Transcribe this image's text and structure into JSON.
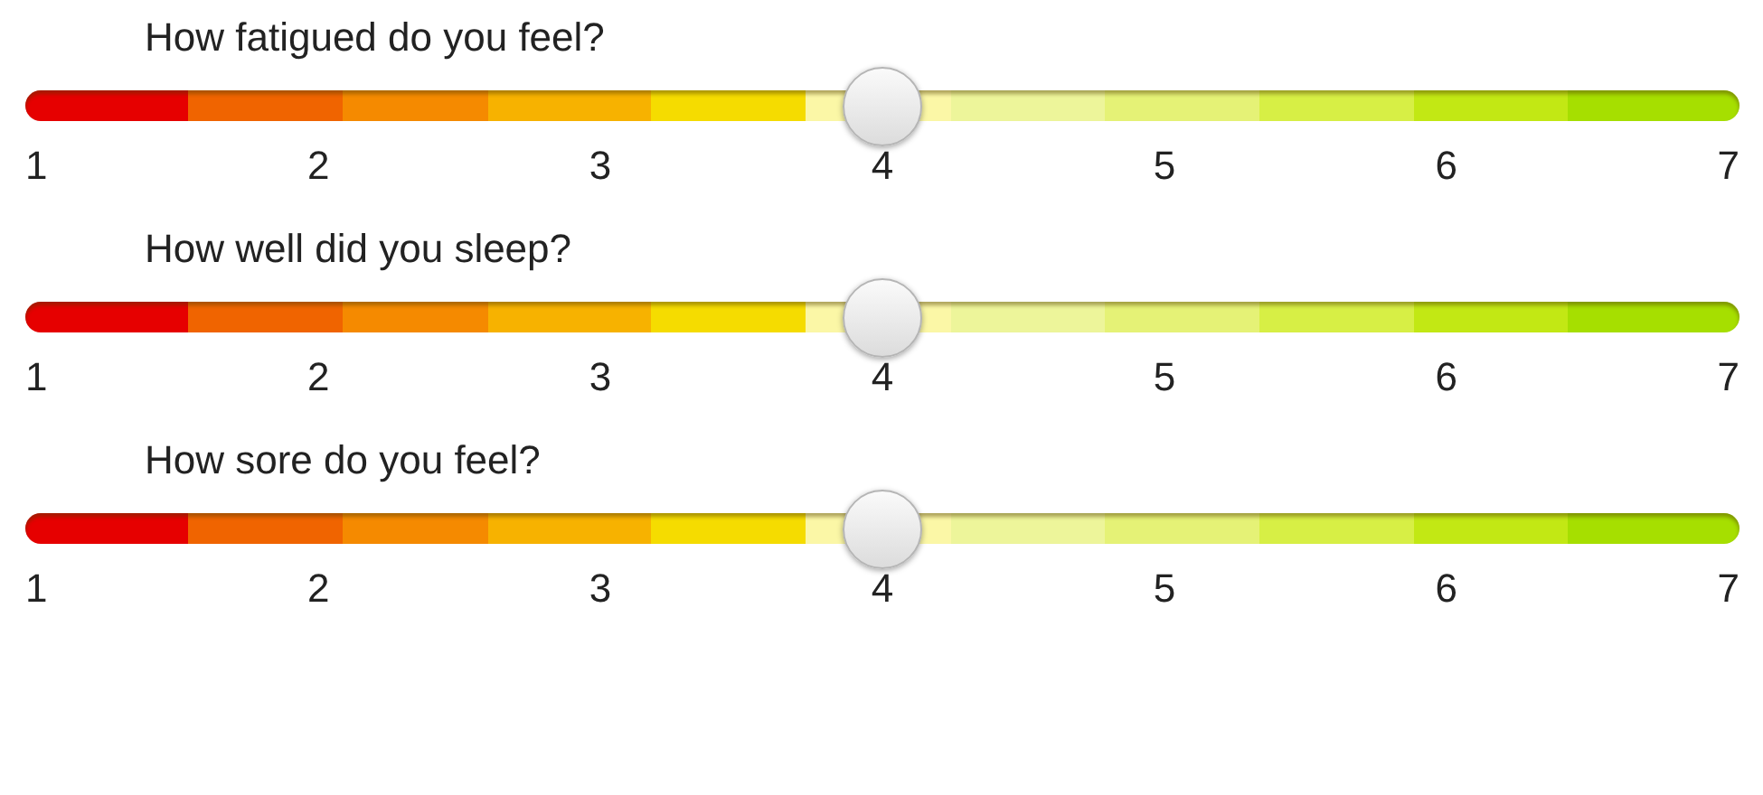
{
  "sliders": [
    {
      "question": "How fatigued do you feel?",
      "level": 0.5,
      "ticks": [
        "1",
        "2",
        "3",
        "4",
        "5",
        "6",
        "7"
      ]
    },
    {
      "question": "How well did you sleep?",
      "level": 0.5,
      "ticks": [
        "1",
        "2",
        "3",
        "4",
        "5",
        "6",
        "7"
      ]
    },
    {
      "question": "How sore do you feel?",
      "level": 0.5,
      "ticks": [
        "1",
        "2",
        "3",
        "4",
        "5",
        "6",
        "7"
      ]
    }
  ]
}
